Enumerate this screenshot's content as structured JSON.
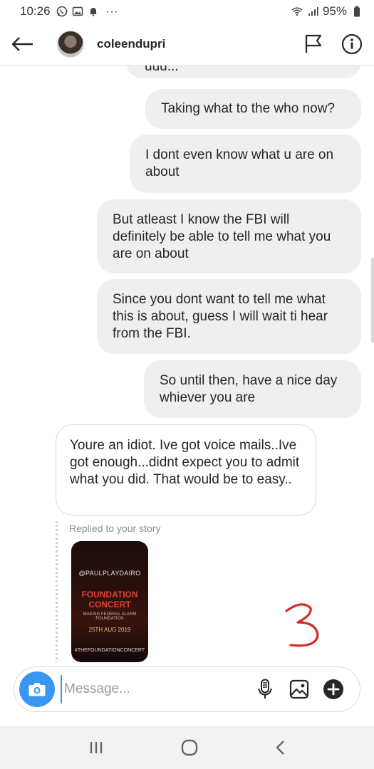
{
  "status_bar": {
    "time": "10:26",
    "dots": "···",
    "battery": "95%"
  },
  "header": {
    "username": "coleendupri"
  },
  "messages": [
    {
      "id": "m0",
      "from": "me",
      "text": "uuu..."
    },
    {
      "id": "m1",
      "from": "me",
      "text": "Taking what to the who now?"
    },
    {
      "id": "m2",
      "from": "me",
      "text": "I dont even know what u are on about"
    },
    {
      "id": "m3",
      "from": "me",
      "text": "But atleast I know the FBI will definitely be able to tell me what you are on about"
    },
    {
      "id": "m4",
      "from": "me",
      "text": "Since you dont want to tell me what this is about, guess I will wait ti hear from the FBI."
    },
    {
      "id": "m5",
      "from": "me",
      "text": "So until then, have a nice day whiever you are"
    },
    {
      "id": "m6",
      "from": "them",
      "text": "Youre an idiot. Ive got voice mails..Ive got enough...didnt expect you to admit what you did. That would be to easy.."
    }
  ],
  "story_reply": {
    "label": "Replied to your story",
    "poster_lines": [
      "@PAULPLAYDAIRO",
      "FOUNDATION",
      "CONCERT",
      "MAKING FEDERAL ALARM FOUNDATION",
      "25TH AUG 2019",
      "",
      "#THEFOUNDATIONCONCERT"
    ]
  },
  "annotation": {
    "text": "3",
    "color": "#d42a2a"
  },
  "composer": {
    "placeholder": "Message..."
  },
  "colors": {
    "accent": "#3897f0",
    "bubble_sent": "#efefef"
  },
  "icons": [
    "back-arrow-icon",
    "flag-icon",
    "info-icon",
    "camera-icon",
    "microphone-icon",
    "image-icon",
    "plus-circle-icon",
    "recent-apps-icon",
    "home-icon",
    "nav-back-icon"
  ]
}
